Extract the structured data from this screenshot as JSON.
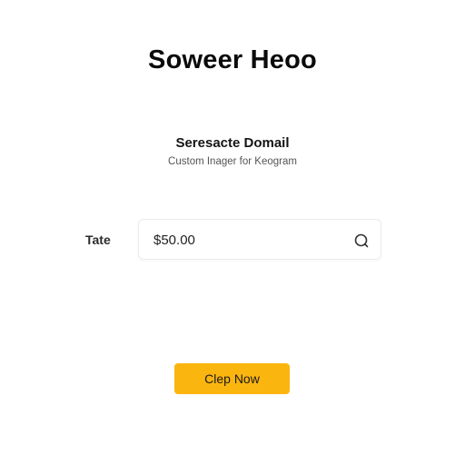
{
  "header": {
    "title": "Soweer Heoo"
  },
  "section": {
    "heading": "Seresacte Domail",
    "subheading": "Custom Inager for Keogram"
  },
  "field": {
    "label": "Tate",
    "value": "$50.00",
    "icon": "search-icon"
  },
  "cta": {
    "label": "Clep Now",
    "color": "#fbb50f"
  }
}
